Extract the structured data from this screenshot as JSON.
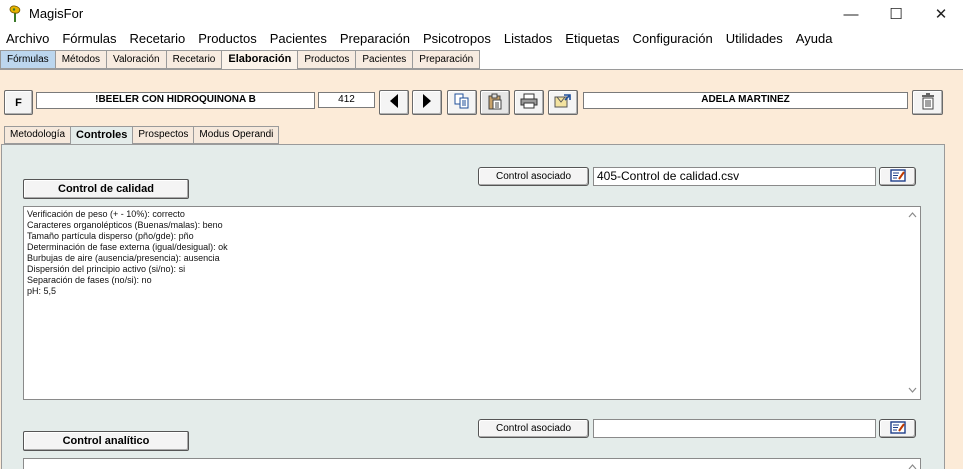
{
  "window": {
    "title": "MagisFor",
    "minimize_glyph": "—",
    "maximize_glyph": "☐",
    "close_glyph": "✕"
  },
  "menu": {
    "items": [
      "Archivo",
      "Fórmulas",
      "Recetario",
      "Productos",
      "Pacientes",
      "Preparación",
      "Psicotropos",
      "Listados",
      "Etiquetas",
      "Configuración",
      "Utilidades",
      "Ayuda"
    ]
  },
  "main_tabs": {
    "items": [
      "Fórmulas",
      "Métodos",
      "Valoración",
      "Recetario",
      "Elaboración",
      "Productos",
      "Pacientes",
      "Preparación"
    ],
    "active": "Elaboración"
  },
  "toolbar": {
    "f_button_label": "F",
    "formula_name": "!BEELER CON HIDROQUINONA B",
    "formula_number": "412",
    "patient_name": "ADELA MARTINEZ",
    "icons": [
      "prev-arrow-icon",
      "next-arrow-icon",
      "copy-icon",
      "paste-icon",
      "print-icon",
      "export-icon",
      "trash-icon"
    ]
  },
  "sub_tabs": {
    "items": [
      "Metodología",
      "Controles",
      "Prospectos",
      "Modus Operandi"
    ],
    "active": "Controles"
  },
  "quality_control": {
    "title_button_label": "Control de calidad",
    "assoc_button_label": "Control asociado",
    "assoc_file": "405-Control de calidad.csv",
    "lines": [
      "Verificación de peso (+ - 10%): correcto",
      "Caracteres organolépticos (Buenas/malas): beno",
      "Tamaño partícula disperso (pño/gde): pño",
      "Determinación de fase externa (igual/desigual): ok",
      "Burbujas de aire (ausencia/presencia): ausencia",
      "Dispersión del principio activo (si/no): si",
      "Separación de fases (no/si): no",
      "pH: 5,5"
    ]
  },
  "analytic_control": {
    "title_button_label": "Control analítico",
    "assoc_button_label": "Control asociado",
    "assoc_file": ""
  },
  "colors": {
    "panel_bg": "#fcebd8",
    "subpanel_bg": "#e4ecea",
    "blue_tab": "#bcd6ee"
  }
}
